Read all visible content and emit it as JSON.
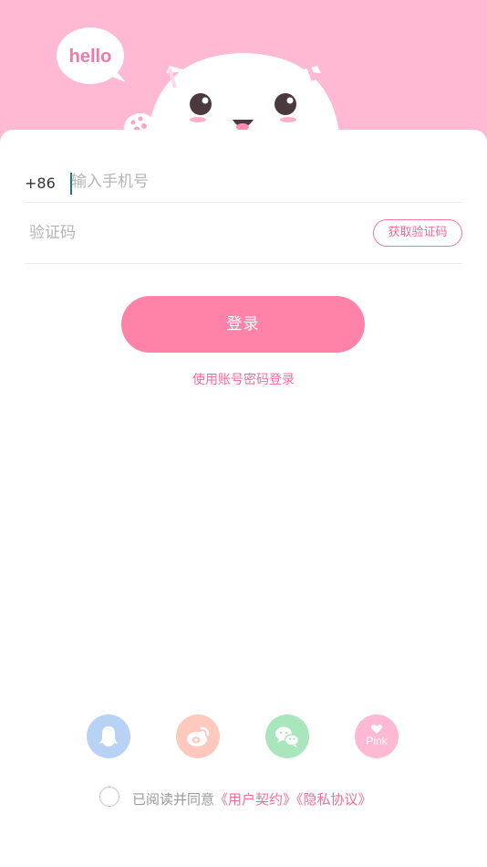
{
  "header": {
    "speech_bubble": "hello"
  },
  "form": {
    "country_code": "+86",
    "phone_placeholder": "输入手机号",
    "code_placeholder": "验证码",
    "get_code_label": "获取验证码"
  },
  "actions": {
    "login_label": "登录",
    "password_login_link": "使用账号密码登录"
  },
  "social": {
    "icons": [
      "qq-icon",
      "weibo-icon",
      "wechat-icon",
      "pink-icon"
    ],
    "pink_label": "Pink"
  },
  "agreement": {
    "text": "已阅读并同意",
    "user_agreement": "《用户契约》",
    "privacy_policy": "《隐私协议》"
  },
  "colors": {
    "brand_pink": "#ffb9d3",
    "button_pink": "#ff82a8",
    "link_pink": "#ef6e98"
  }
}
